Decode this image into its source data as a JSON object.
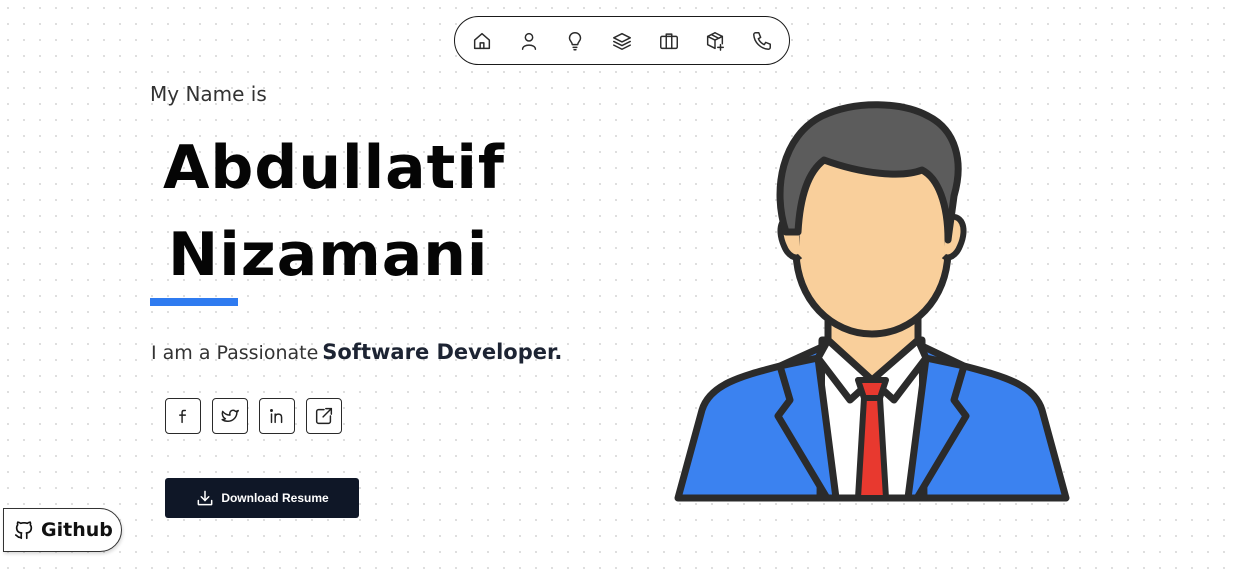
{
  "nav": {
    "items": [
      {
        "icon": "home-icon"
      },
      {
        "icon": "user-icon"
      },
      {
        "icon": "lightbulb-icon"
      },
      {
        "icon": "layers-icon"
      },
      {
        "icon": "briefcase-icon"
      },
      {
        "icon": "package-icon"
      },
      {
        "icon": "phone-icon"
      }
    ]
  },
  "hero": {
    "intro": "My Name is",
    "first_name": "Abdullatif",
    "last_name": "Nizamani",
    "tagline_plain": "I am a Passionate",
    "tagline_strong": "Software Developer."
  },
  "socials": [
    "facebook-icon",
    "twitter-icon",
    "linkedin-icon",
    "external-link-icon"
  ],
  "download": {
    "label": "Download Resume",
    "icon": "download-icon"
  },
  "github": {
    "label": "Github",
    "icon": "github-icon"
  },
  "colors": {
    "accent": "#2f7bf0",
    "button_bg": "#0f1727",
    "suit": "#3b82f0",
    "tie": "#e8392f",
    "skin": "#f9cf9b",
    "hair": "#5c5c5c"
  }
}
